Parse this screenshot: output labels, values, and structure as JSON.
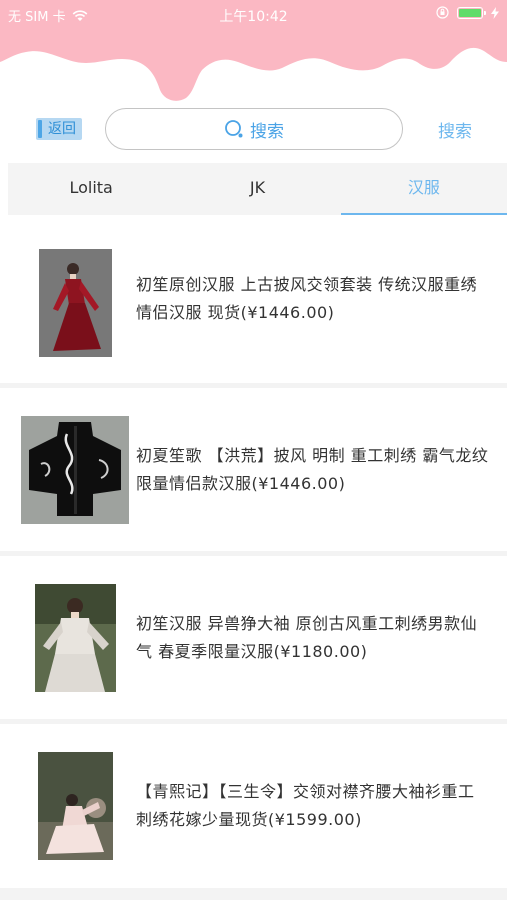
{
  "status_bar": {
    "carrier": "无 SIM 卡",
    "time": "上午10:42"
  },
  "header": {
    "back_label": "返回",
    "search_placeholder": "搜索",
    "search_button_label": "搜索"
  },
  "tabs": [
    {
      "label": "Lolita",
      "active": false
    },
    {
      "label": "JK",
      "active": false
    },
    {
      "label": "汉服",
      "active": true
    }
  ],
  "products": [
    {
      "title": "初笙原创汉服  上古披风交领套装  传统汉服重绣 情侣汉服 现货(¥1446.00)"
    },
    {
      "title": "初夏笙歌 【洪荒】披风 明制 重工刺绣 霸气龙纹 限量情侣款汉服(¥1446.00)"
    },
    {
      "title": "初笙汉服  异兽狰大袖  原创古风重工刺绣男款仙气 春夏季限量汉服(¥1180.00)"
    },
    {
      "title": "【青熙记】【三生令】交领对襟齐腰大袖衫重工刺绣花嫁少量现货(¥1599.00)"
    }
  ],
  "colors": {
    "header_pink": "#fbb8c3",
    "accent_blue": "#6db7ee",
    "tab_bg": "#f4f4f4"
  }
}
